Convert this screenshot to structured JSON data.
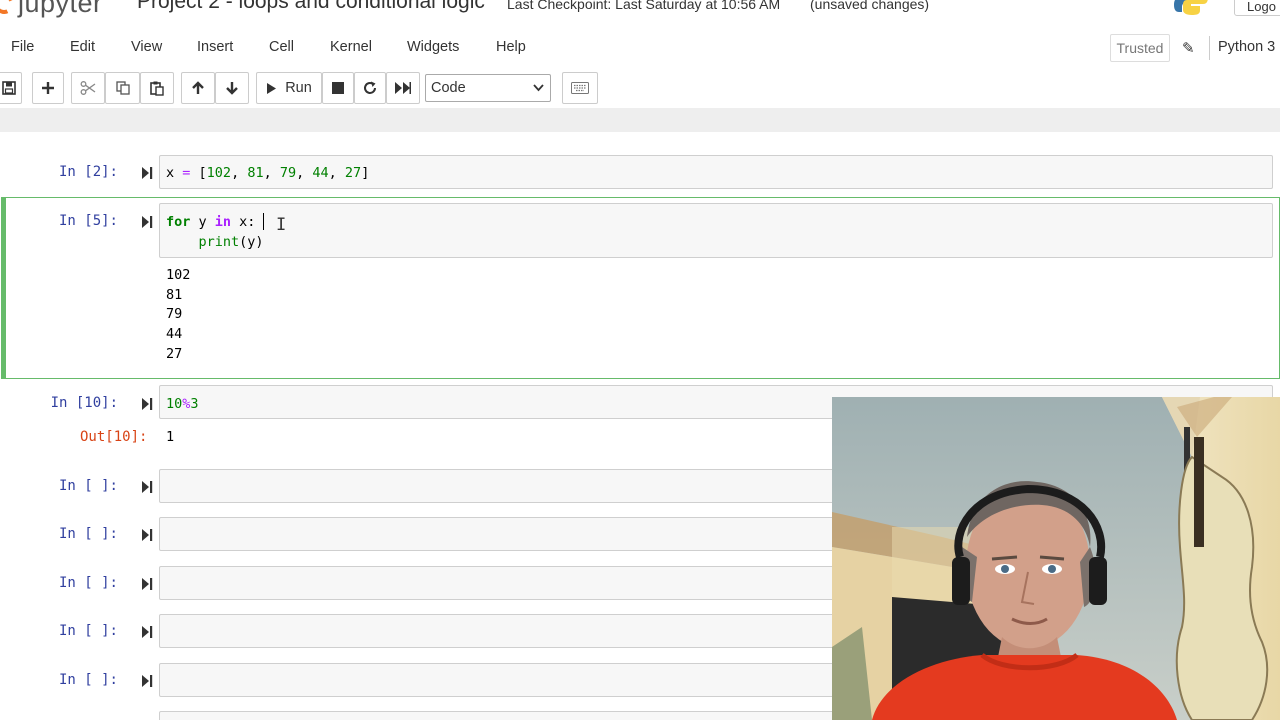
{
  "header": {
    "app_name": "jupyter",
    "notebook_title": "Project 2 - loops and conditional logic",
    "checkpoint": "Last Checkpoint: Last Saturday at 10:56 AM",
    "unsaved": "(unsaved changes)",
    "logout_label": "Logo"
  },
  "menu": {
    "items": [
      "File",
      "Edit",
      "View",
      "Insert",
      "Cell",
      "Kernel",
      "Widgets",
      "Help"
    ],
    "trusted_label": "Trusted",
    "kernel_name": "Python 3"
  },
  "toolbar": {
    "run_label": "Run",
    "cell_type": "Code",
    "icons": [
      "save-icon",
      "plus-icon",
      "cut-icon",
      "copy-icon",
      "paste-icon",
      "arrow-up-icon",
      "arrow-down-icon",
      "play-icon",
      "stop-icon",
      "restart-icon",
      "fast-forward-icon",
      "keyboard-icon"
    ]
  },
  "cells": [
    {
      "prompt": "In [2]:",
      "code": "x = [102, 81, 79, 44, 27]"
    },
    {
      "prompt": "In [5]:",
      "code_line1": "for y in x:",
      "code_line2": "    print(y)",
      "outputs": [
        "102",
        "81",
        "79",
        "44",
        "27"
      ]
    },
    {
      "prompt": "In [10]:",
      "code": "10%3",
      "out_prompt": "Out[10]:",
      "out_value": "1"
    },
    {
      "prompt": "In [ ]:"
    },
    {
      "prompt": "In [ ]:"
    },
    {
      "prompt": "In [ ]:"
    },
    {
      "prompt": "In [ ]:"
    },
    {
      "prompt": "In [ ]:"
    }
  ],
  "colors": {
    "prompt_in": "#303f9f",
    "prompt_out": "#d84315",
    "selected_border": "#66bb6a",
    "keyword": "#008000",
    "operator": "#aa22ff"
  }
}
